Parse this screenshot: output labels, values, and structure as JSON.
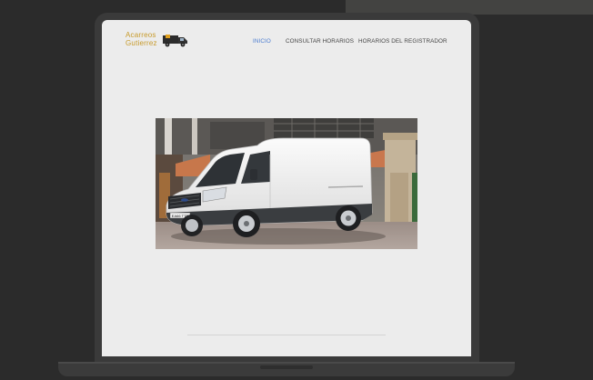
{
  "site": {
    "logo_line1": "Acarreos",
    "logo_line2": "Gutierrez",
    "nav": [
      {
        "label": "INICIO",
        "active": true
      },
      {
        "label": "CONSULTAR HORARIOS",
        "active": false
      },
      {
        "label": "HORARIOS DEL REGISTRADOR",
        "active": false
      }
    ]
  },
  "hero": {
    "image": "white-cargo-van-photo",
    "plate": "EA66 TTE"
  },
  "colors": {
    "accent": "#4a7bd0",
    "logo": "#c79a2a",
    "page_bg": "#ececec",
    "frame": "#3a3a3a"
  }
}
